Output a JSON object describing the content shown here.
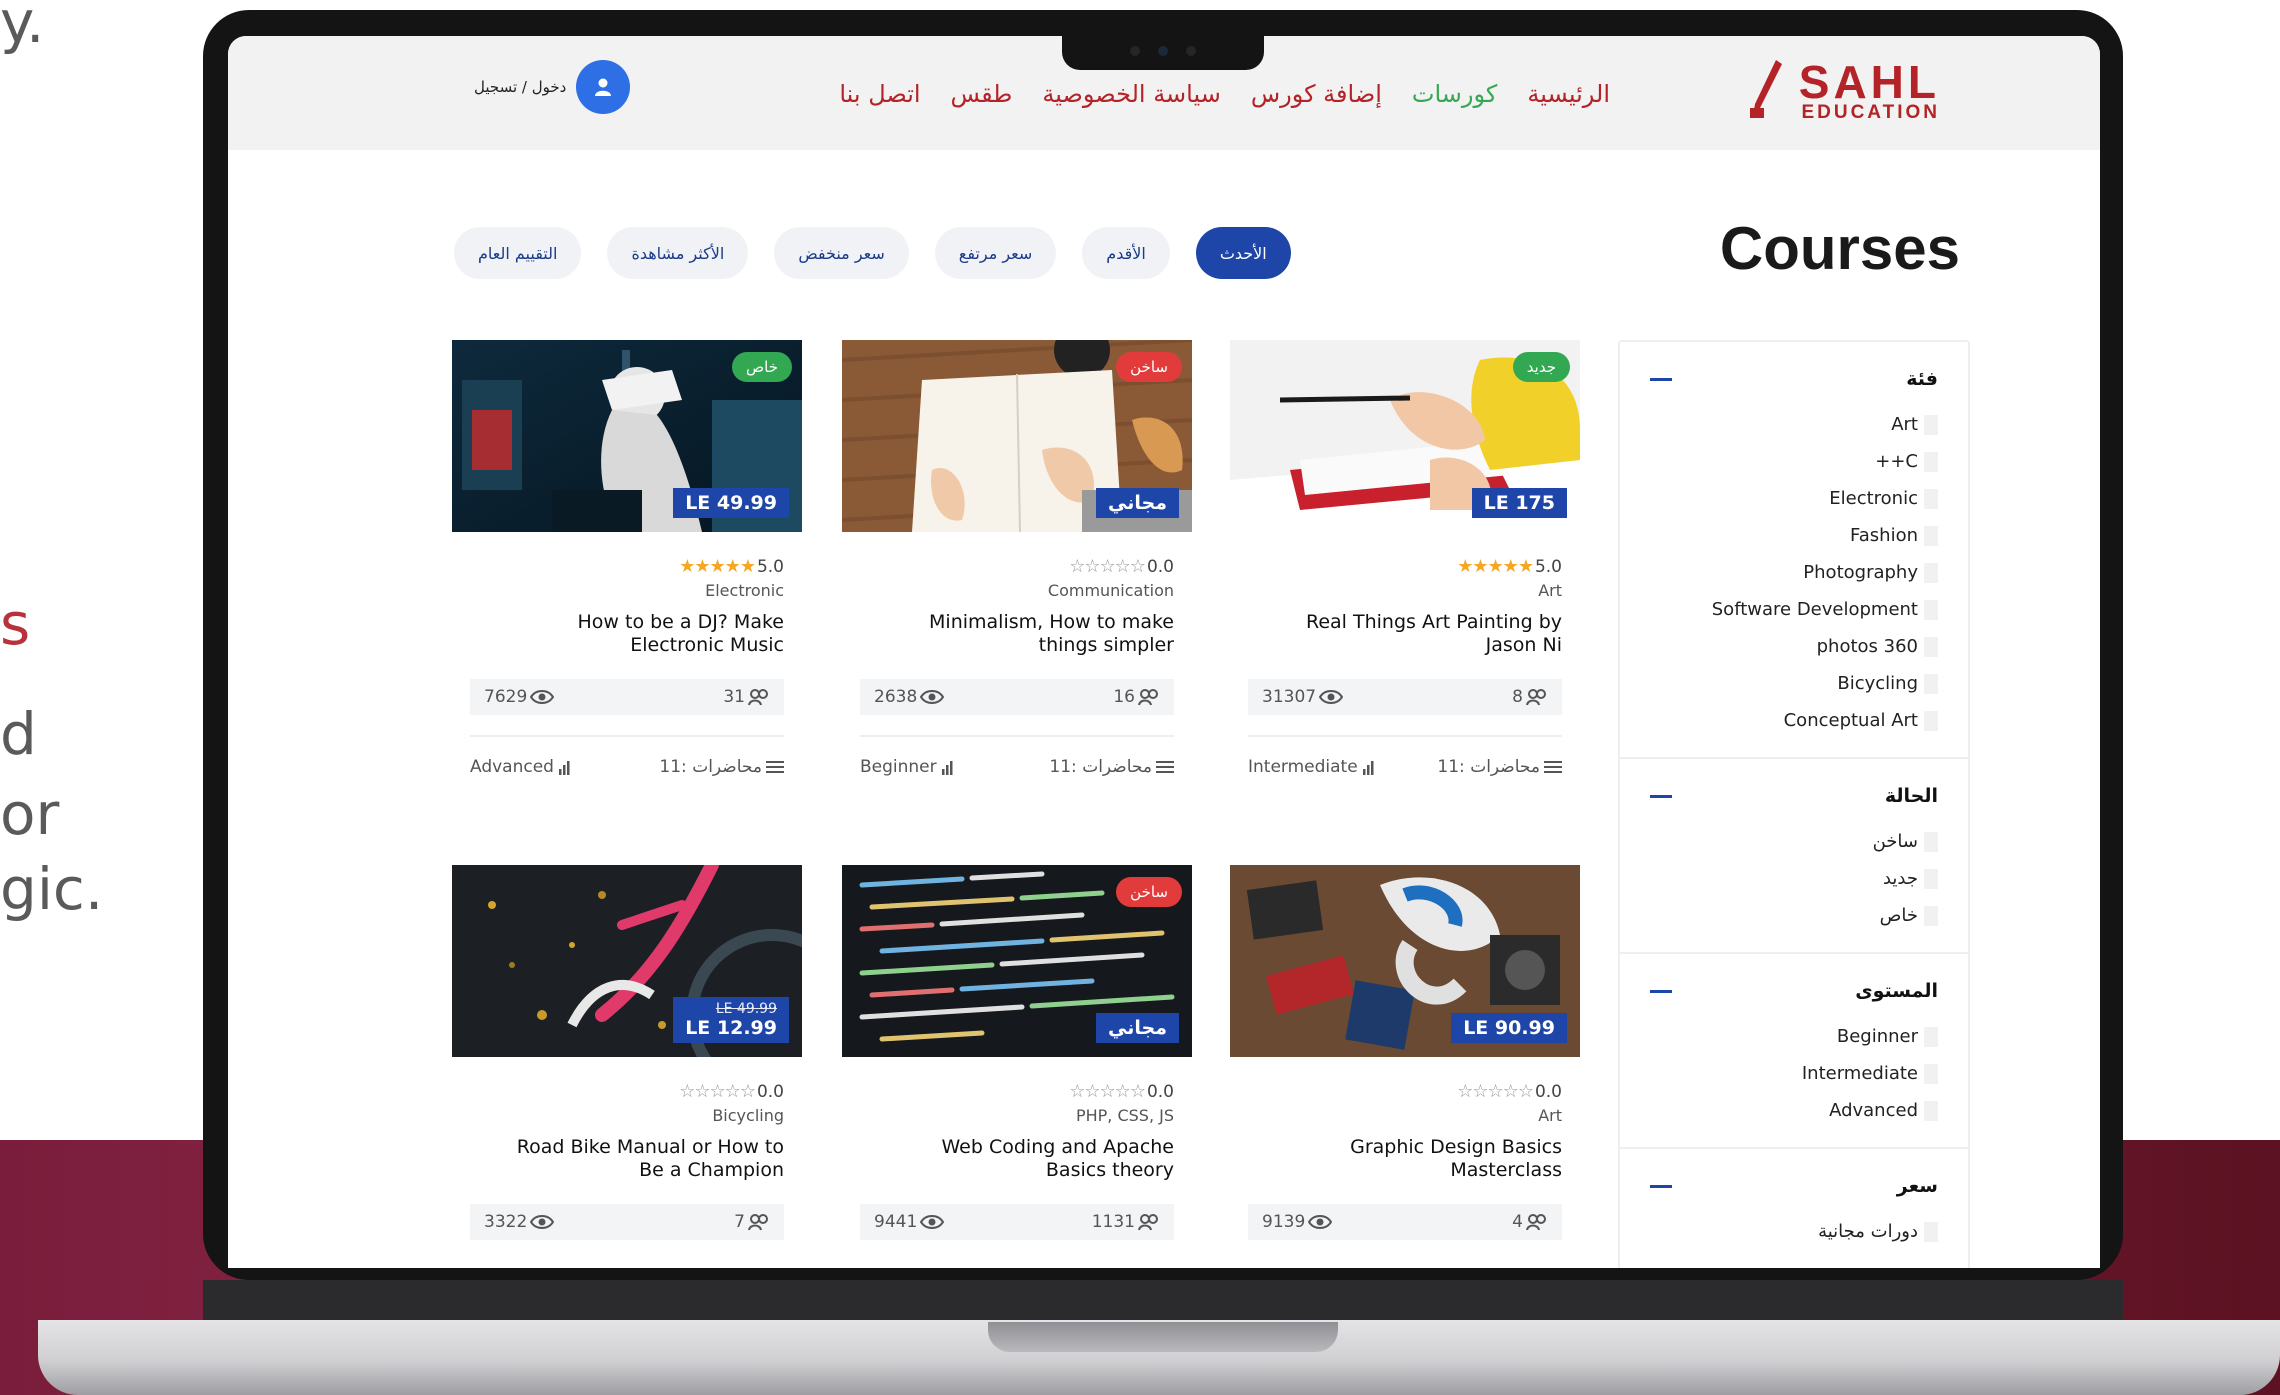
{
  "backdrop": {
    "fragments": [
      "y.",
      "s",
      "d",
      "or",
      "gic."
    ]
  },
  "header": {
    "logo_top": "SAHL",
    "logo_bottom": "EDUCATION",
    "nav": [
      {
        "label": "الرئيسية",
        "active": false
      },
      {
        "label": "كورسات",
        "active": true
      },
      {
        "label": "إضافة كورس",
        "active": false
      },
      {
        "label": "سياسة الخصوصية",
        "active": false
      },
      {
        "label": "طقس",
        "active": false
      },
      {
        "label": "اتصل بنا",
        "active": false
      }
    ],
    "login_label": "دخول / تسجيل"
  },
  "page_title": "Courses",
  "filters": [
    "الأحدث",
    "الأقدم",
    "سعر مرتفع",
    "سعر منخفض",
    "الأكثر مشاهدة",
    "التقييم العام"
  ],
  "sidebar": {
    "sections": [
      {
        "title": "فئة",
        "items": [
          "Art",
          "++C",
          "Electronic",
          "Fashion",
          "Photography",
          "Software Development",
          "photos 360",
          "Bicycling",
          "Conceptual Art"
        ]
      },
      {
        "title": "الحالة",
        "items": [
          "ساخن",
          "جديد",
          "خاص"
        ]
      },
      {
        "title": "المستوى",
        "items": [
          "Beginner",
          "Intermediate",
          "Advanced"
        ]
      },
      {
        "title": "سعر",
        "items": [
          "دورات مجانية"
        ]
      }
    ]
  },
  "courses": [
    {
      "title": "How to be a DJ? Make Electronic Music",
      "category": "Electronic",
      "rating": "5.0",
      "full_stars": 5,
      "badge": "خاص",
      "badge_color": "green",
      "price": "LE 49.99",
      "old_price": "",
      "views": "7629",
      "students": "31",
      "level": "Advanced",
      "lectures": "11: محاضرات"
    },
    {
      "title": "Minimalism, How to make things simpler",
      "category": "Communication",
      "rating": "0.0",
      "full_stars": 0,
      "badge": "ساخن",
      "badge_color": "red",
      "price": "مجاني",
      "old_price": "",
      "views": "2638",
      "students": "16",
      "level": "Beginner",
      "lectures": "11: محاضرات"
    },
    {
      "title": "Real Things Art Painting by Jason Ni",
      "category": "Art",
      "rating": "5.0",
      "full_stars": 5,
      "badge": "جديد",
      "badge_color": "green",
      "price": "LE 175",
      "old_price": "",
      "views": "31307",
      "students": "8",
      "level": "Intermediate",
      "lectures": "11: محاضرات"
    },
    {
      "title": "Road Bike Manual or How to Be a Champion",
      "category": "Bicycling",
      "rating": "0.0",
      "full_stars": 0,
      "badge": "",
      "badge_color": "",
      "price": "LE 12.99",
      "old_price": "LE 49.99",
      "views": "3322",
      "students": "7",
      "level": "",
      "lectures": ""
    },
    {
      "title": "Web Coding and Apache Basics theory",
      "category": "PHP, CSS, JS",
      "rating": "0.0",
      "full_stars": 0,
      "badge": "ساخن",
      "badge_color": "red",
      "price": "مجاني",
      "old_price": "",
      "views": "9441",
      "students": "1131",
      "level": "",
      "lectures": ""
    },
    {
      "title": "Graphic Design Basics Masterclass",
      "category": "Art",
      "rating": "0.0",
      "full_stars": 0,
      "badge": "",
      "badge_color": "",
      "price": "LE 90.99",
      "old_price": "",
      "views": "9139",
      "students": "4",
      "level": "",
      "lectures": ""
    }
  ],
  "colors": {
    "brand_red": "#b32327",
    "accent_blue": "#1e46a8",
    "active_green": "#35a853",
    "star": "#f5a623"
  }
}
